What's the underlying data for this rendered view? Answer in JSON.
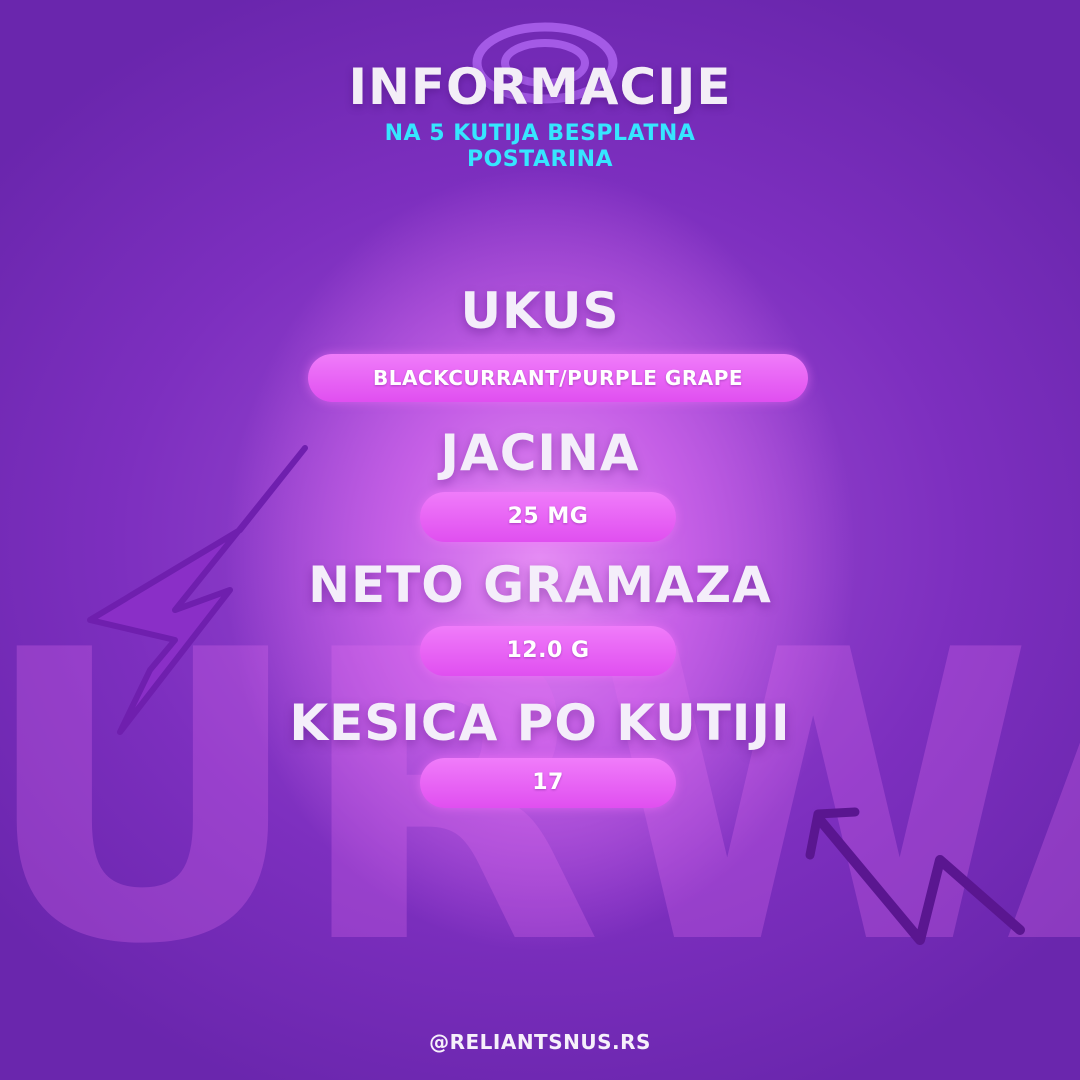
{
  "header": {
    "title": "INFORMACIJE",
    "subtitle_line1": "NA 5 KUTIJA BESPLATNA",
    "subtitle_line2": "POSTARINA"
  },
  "background": {
    "watermark_text": "URWA"
  },
  "sections": [
    {
      "label": "UKUS",
      "value": "BLACKCURRANT/PURPLE GRAPE"
    },
    {
      "label": "JACINA",
      "value": "25 MG"
    },
    {
      "label": "NETO GRAMAZA",
      "value": "12.0 G"
    },
    {
      "label": "KESICA PO KUTIJI",
      "value": "17"
    }
  ],
  "footer": {
    "handle": "@RELIANTSNUS.RS"
  },
  "colors": {
    "accent_cyan": "#36e6ff",
    "pill_pink": "#e858f2",
    "background_purple": "#7d2fbf"
  },
  "icons": [
    "swirl-doodle-icon",
    "lightning-bolt-icon",
    "arrow-doodle-icon"
  ]
}
